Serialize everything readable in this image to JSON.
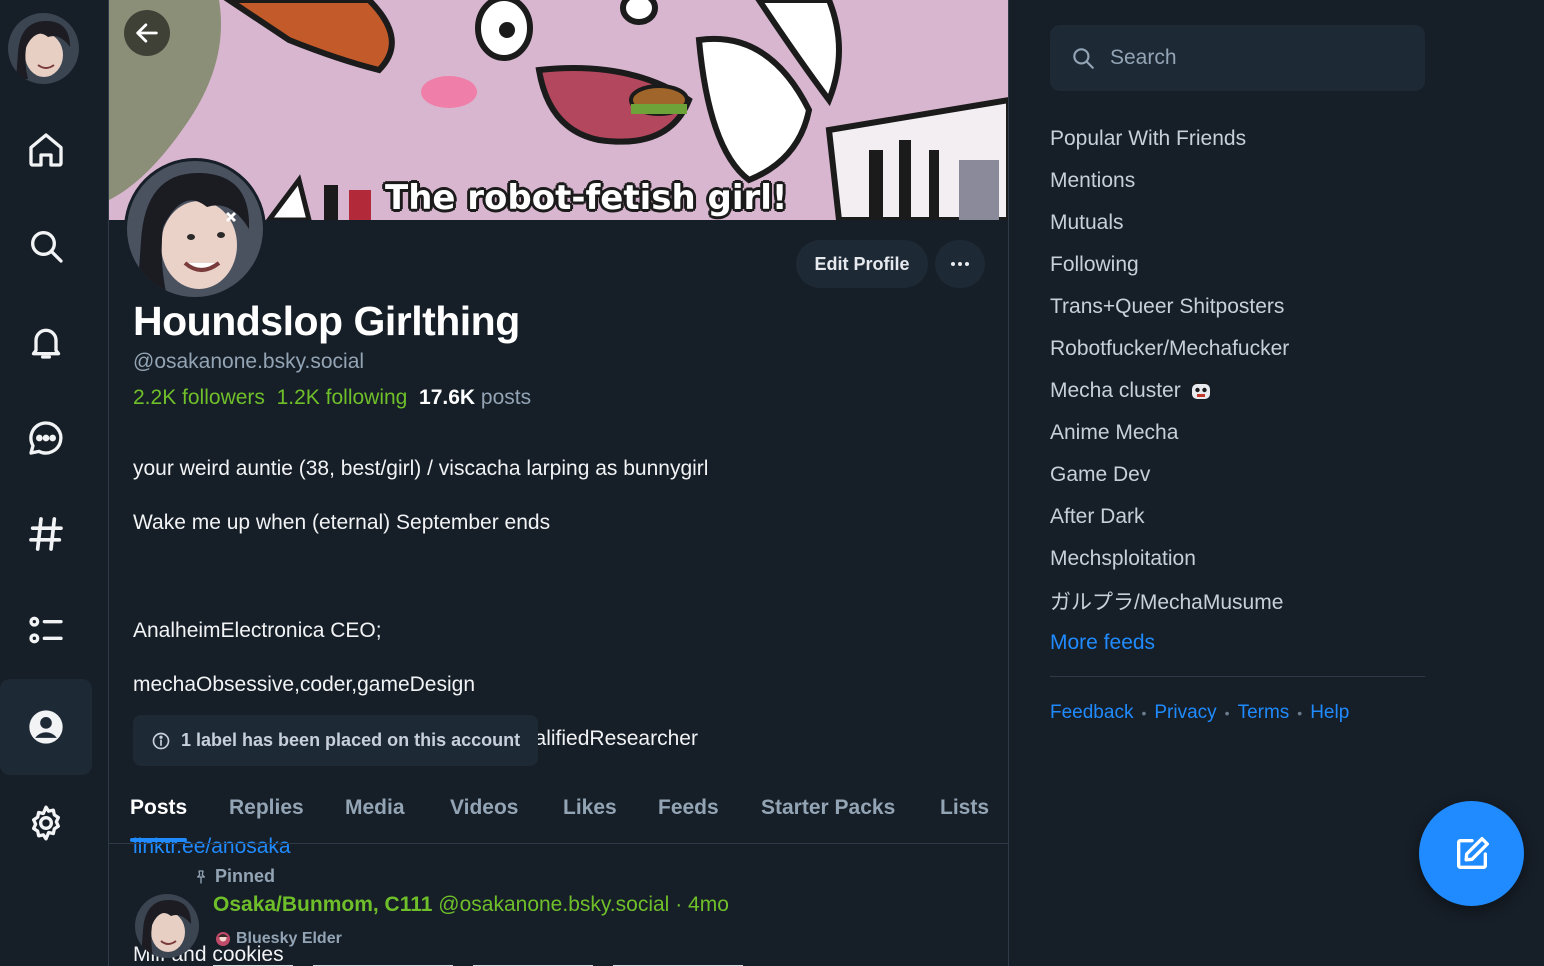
{
  "nav": {
    "items": [
      {
        "name": "home",
        "icon": "home-icon"
      },
      {
        "name": "search",
        "icon": "search-icon"
      },
      {
        "name": "notifications",
        "icon": "bell-icon"
      },
      {
        "name": "chat",
        "icon": "chat-icon"
      },
      {
        "name": "feeds",
        "icon": "hashtag-icon"
      },
      {
        "name": "lists",
        "icon": "list-icon"
      },
      {
        "name": "profile",
        "icon": "user-circle-icon",
        "active": true
      },
      {
        "name": "settings",
        "icon": "gear-icon"
      }
    ]
  },
  "profile": {
    "banner_caption": "The robot-fetish girl!",
    "display_name": "Houndslop Girlthing",
    "handle": "@osakanone.bsky.social",
    "followers_count": "2.2K",
    "followers_label": "followers",
    "following_count": "1.2K",
    "following_label": "following",
    "posts_count": "17.6K",
    "posts_label": "posts",
    "bio_line1": "your weird auntie (38, best/girl) / viscacha larping as bunnygirl",
    "bio_line2": "Wake me up when (eternal) September ends",
    "bio_line3": "AnalheimElectronica CEO;",
    "bio_line4": "mechaObsessive,coder,gameDesign",
    "bio_line5": "humanFactors,highPoweredMutant,OverqualifiedResearcher",
    "bio_link": "linktr.ee/anosaka",
    "bio_line6": "Milf and cookies",
    "label_notice": "1 label has been placed on this account",
    "edit_button": "Edit Profile"
  },
  "tabs": [
    {
      "label": "Posts",
      "active": true
    },
    {
      "label": "Replies"
    },
    {
      "label": "Media"
    },
    {
      "label": "Videos"
    },
    {
      "label": "Likes"
    },
    {
      "label": "Feeds"
    },
    {
      "label": "Starter Packs"
    },
    {
      "label": "Lists"
    }
  ],
  "post": {
    "pinned_label": "Pinned",
    "author_name": "Osaka/Bunmom, C111",
    "author_handle": "@osakanone.bsky.social",
    "separator": "·",
    "time": "4mo",
    "badge": "Bluesky Elder"
  },
  "search": {
    "placeholder": "Search"
  },
  "feeds": [
    "Popular With Friends",
    "Mentions",
    "Mutuals",
    "Following",
    "Trans+Queer Shitposters",
    "Robotfucker/Mechafucker",
    "Mecha cluster",
    "Anime Mecha",
    "Game Dev",
    "After Dark",
    "Mechsploitation",
    "ガルプラ/MechaMusume"
  ],
  "more_feeds": "More feeds",
  "footer": {
    "feedback": "Feedback",
    "privacy": "Privacy",
    "terms": "Terms",
    "help": "Help",
    "dot": "•"
  },
  "colors": {
    "background": "#161e27",
    "accent": "#208bfe",
    "highlight_green": "#6fbf2a",
    "muted": "#93a4b5"
  }
}
